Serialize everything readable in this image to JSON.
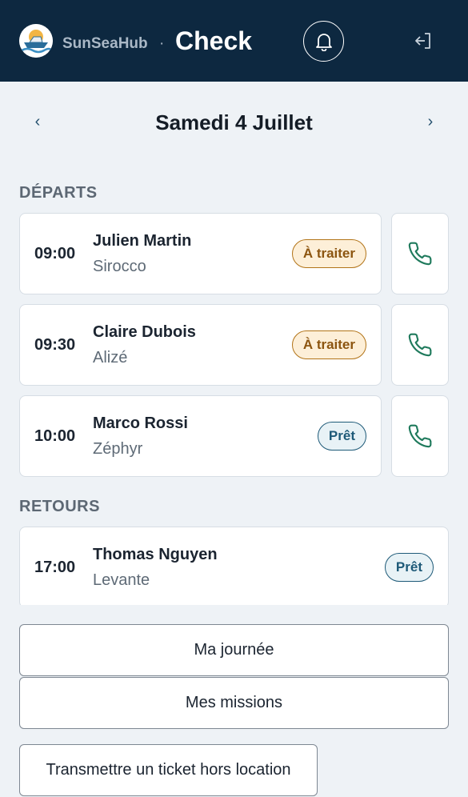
{
  "header": {
    "brand": "SunSeaHub",
    "separator": "·",
    "app_title": "Check",
    "icons": {
      "logo": "boat-sun-logo",
      "notifications": "bell-icon",
      "logout": "logout-icon"
    }
  },
  "date_nav": {
    "prev": "‹",
    "next": "›",
    "title": "Samedi 4 Juillet"
  },
  "departures": {
    "title": "DÉPARTS",
    "items": [
      {
        "time": "09:00",
        "name": "Julien Martin",
        "boat": "Sirocco",
        "status": "À traiter"
      },
      {
        "time": "09:30",
        "name": "Claire Dubois",
        "boat": "Alizé",
        "status": "À traiter"
      },
      {
        "time": "10:00",
        "name": "Marco Rossi",
        "boat": "Zéphyr",
        "status": "Prêt"
      }
    ]
  },
  "returns": {
    "title": "RETOURS",
    "items": [
      {
        "time": "17:00",
        "name": "Thomas Nguyen",
        "boat": "Levante",
        "status": "Prêt"
      }
    ]
  },
  "colors": {
    "header_bg": "#0d2840",
    "page_bg": "#eef2f6",
    "pending_bg": "#fdefd8",
    "pending_text": "#8c5510",
    "ready_bg": "#e8f2f6",
    "ready_text": "#1e5a78",
    "phone_icon": "#1f7a5c"
  },
  "actions": {
    "my_day": "Ma journée",
    "my_missions": "Mes missions",
    "ticket": "Transmettre un ticket hors location"
  }
}
